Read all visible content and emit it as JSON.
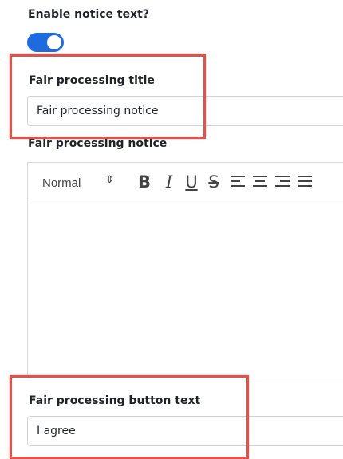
{
  "enable_notice": {
    "label": "Enable notice text?",
    "enabled": true
  },
  "title_field": {
    "label": "Fair processing title",
    "value": "Fair processing notice"
  },
  "notice_field": {
    "label": "Fair processing notice",
    "toolbar": {
      "format_select": "Normal",
      "format_caret": "↕",
      "bold": "B",
      "italic": "I",
      "underline": "U",
      "strike": "S"
    },
    "content": ""
  },
  "button_text_field": {
    "label": "Fair processing button text",
    "value": "I agree"
  },
  "colors": {
    "toggle_on": "#1e6be0",
    "highlight": "#e0524a"
  }
}
